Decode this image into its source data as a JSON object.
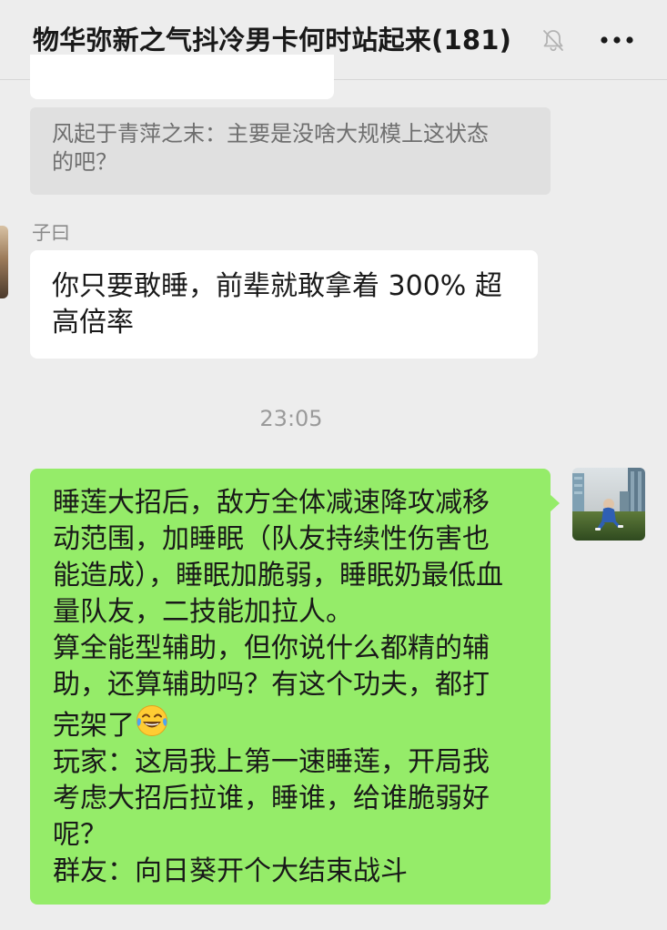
{
  "header": {
    "title": "物华弥新之气抖冷男卡何时站起来",
    "member_count": "(181)",
    "mute_icon": "bell-slash-icon",
    "more_icon": "more-dots-icon"
  },
  "messages": {
    "quote": {
      "lines": [
        "风起于青萍之末：主要是没啥大规模上这状态",
        "的吧？"
      ]
    },
    "incoming": {
      "sender": "子曰",
      "lines": [
        "你只要敢睡，前辈就敢拿着 300% 超",
        "高倍率"
      ]
    },
    "timestamp": "23:05",
    "outgoing": {
      "lines": [
        "睡莲大招后，敌方全体减速降攻减移",
        "动范围，加睡眠（队友持续性伤害也",
        "能造成），睡眠加脆弱，睡眠奶最低血",
        "量队友，二技能加拉人。",
        "算全能型辅助，但你说什么都精的辅",
        "助，还算辅助吗？有这个功夫，都打",
        "完架了",
        "玩家：这局我上第一速睡莲，开局我",
        "考虑大招后拉谁，睡谁，给谁脆弱好",
        "呢？",
        "群友：向日葵开个大结束战斗"
      ],
      "emoji": "😂",
      "emoji_icon": "laughing-tears-emoji"
    }
  },
  "colors": {
    "background": "#ededed",
    "incoming_bubble": "#ffffff",
    "outgoing_bubble": "#95ec69",
    "quote_bubble": "#e0e0e0"
  }
}
